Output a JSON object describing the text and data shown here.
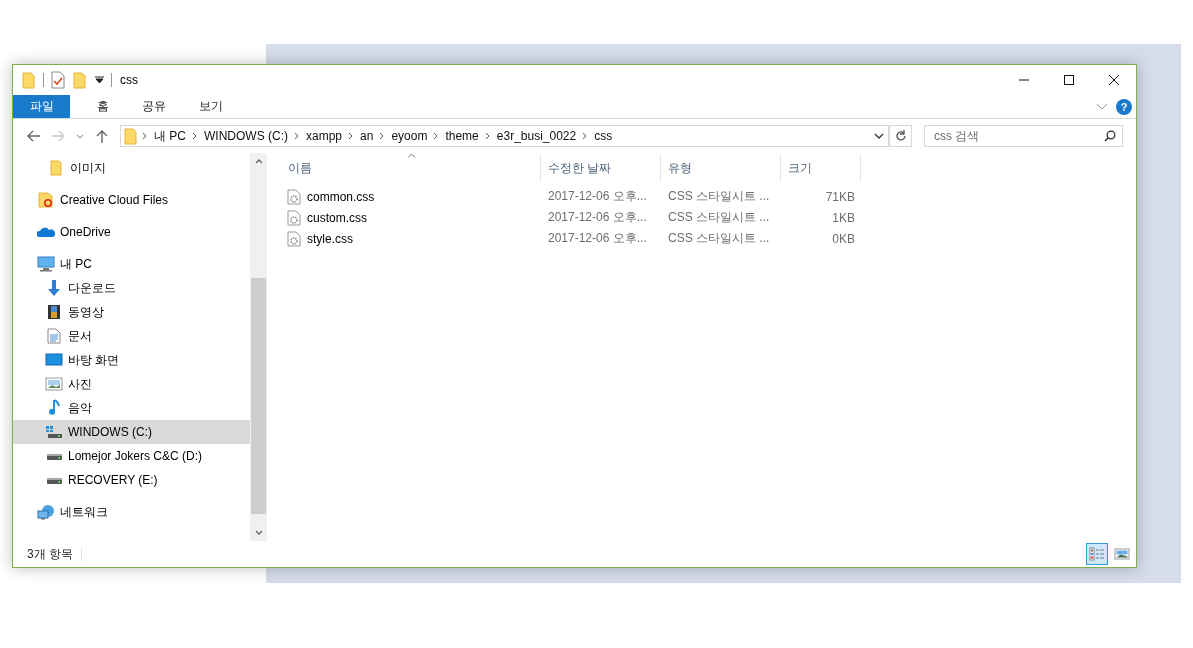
{
  "window": {
    "title": "css"
  },
  "ribbon": {
    "tabs": [
      {
        "label": "파일",
        "kind": "file",
        "selected": false
      },
      {
        "label": "홈",
        "kind": "tab",
        "selected": false
      },
      {
        "label": "공유",
        "kind": "tab",
        "selected": false
      },
      {
        "label": "보기",
        "kind": "tab",
        "selected": false
      }
    ],
    "help": "?"
  },
  "navigation": {
    "back": {
      "disabled": false
    },
    "forward": {
      "disabled": true
    }
  },
  "address": {
    "path": [
      "내 PC",
      "WINDOWS (C:)",
      "xampp",
      "an",
      "eyoom",
      "theme",
      "e3r_busi_0022",
      "css"
    ]
  },
  "search": {
    "placeholder": "css 검색"
  },
  "sidebar": {
    "scrolled_children": [
      {
        "label": "이미지",
        "kind": "folder",
        "selected": false
      }
    ],
    "items": [
      {
        "label": "Creative Cloud Files",
        "kind": "cc",
        "selected": false
      },
      {
        "label": "OneDrive",
        "kind": "onedrive",
        "selected": false
      },
      {
        "label": "내 PC",
        "kind": "pc",
        "selected": false,
        "children": [
          {
            "label": "다운로드",
            "kind": "download",
            "selected": false
          },
          {
            "label": "동영상",
            "kind": "video",
            "selected": false
          },
          {
            "label": "문서",
            "kind": "document",
            "selected": false
          },
          {
            "label": "바탕 화면",
            "kind": "desktop",
            "selected": false
          },
          {
            "label": "사진",
            "kind": "picture",
            "selected": false
          },
          {
            "label": "음악",
            "kind": "music",
            "selected": false
          },
          {
            "label": "WINDOWS (C:)",
            "kind": "windrive",
            "selected": true
          },
          {
            "label": "Lomejor Jokers C&C (D:)",
            "kind": "drive",
            "selected": false
          },
          {
            "label": "RECOVERY (E:)",
            "kind": "drive",
            "selected": false
          }
        ]
      },
      {
        "label": "네트워크",
        "kind": "network",
        "selected": false
      }
    ]
  },
  "table": {
    "columns": [
      {
        "label": "이름",
        "sorted": true
      },
      {
        "label": "수정한 날짜",
        "sorted": false
      },
      {
        "label": "유형",
        "sorted": false
      },
      {
        "label": "크기",
        "sorted": false
      }
    ],
    "rows": [
      {
        "name": "common.css",
        "modified": "2017-12-06 오후...",
        "type": "CSS 스타일시트 ...",
        "size": "71KB"
      },
      {
        "name": "custom.css",
        "modified": "2017-12-06 오후...",
        "type": "CSS 스타일시트 ...",
        "size": "1KB"
      },
      {
        "name": "style.css",
        "modified": "2017-12-06 오후...",
        "type": "CSS 스타일시트 ...",
        "size": "0KB"
      }
    ]
  },
  "status_bar": {
    "text": "3개 항목",
    "views": [
      {
        "kind": "details",
        "selected": true
      },
      {
        "kind": "large-icons",
        "selected": false
      }
    ]
  }
}
